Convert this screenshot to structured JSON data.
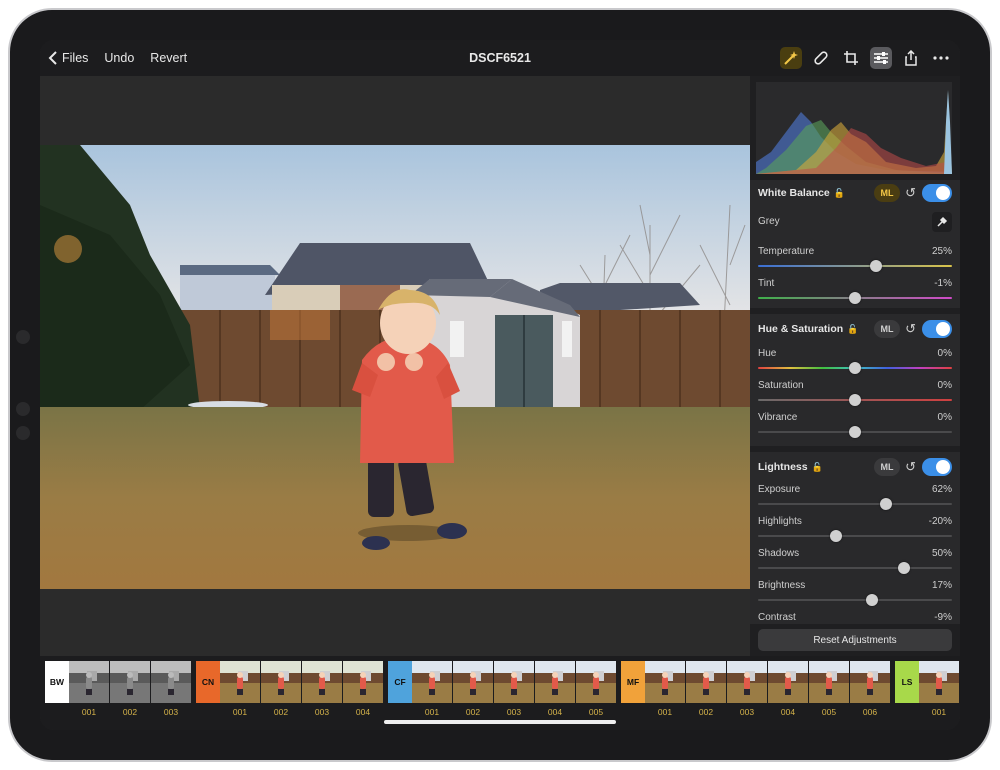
{
  "topbar": {
    "back_label": "Files",
    "undo_label": "Undo",
    "revert_label": "Revert",
    "title": "DSCF6521",
    "tools": [
      "ml-enhance-icon",
      "repair-bandage-icon",
      "crop-icon",
      "adjust-sliders-icon",
      "share-icon",
      "more-icon"
    ]
  },
  "panel": {
    "white_balance": {
      "title": "White Balance",
      "ml_label": "ML",
      "grey_label": "Grey",
      "rows": [
        {
          "label": "Temperature",
          "value": "25%",
          "level": 0.61
        },
        {
          "label": "Tint",
          "value": "-1%",
          "level": 0.5
        }
      ]
    },
    "hue_saturation": {
      "title": "Hue & Saturation",
      "ml_label": "ML",
      "rows": [
        {
          "label": "Hue",
          "value": "0%",
          "level": 0.5
        },
        {
          "label": "Saturation",
          "value": "0%",
          "level": 0.5
        },
        {
          "label": "Vibrance",
          "value": "0%",
          "level": 0.5
        }
      ]
    },
    "lightness": {
      "title": "Lightness",
      "ml_label": "ML",
      "rows": [
        {
          "label": "Exposure",
          "value": "62%",
          "level": 0.66
        },
        {
          "label": "Highlights",
          "value": "-20%",
          "level": 0.4
        },
        {
          "label": "Shadows",
          "value": "50%",
          "level": 0.75
        },
        {
          "label": "Brightness",
          "value": "17%",
          "level": 0.59
        },
        {
          "label": "Contrast",
          "value": "-9%",
          "level": 0.45
        }
      ]
    },
    "reset_label": "Reset Adjustments"
  },
  "presets": [
    {
      "code": "BW",
      "color": "#ffffff",
      "text_color": "#111111",
      "items": [
        "001",
        "002",
        "003"
      ]
    },
    {
      "code": "CN",
      "color": "#e8682a",
      "text_color": "#111111",
      "items": [
        "001",
        "002",
        "003",
        "004"
      ]
    },
    {
      "code": "CF",
      "color": "#4fa3dc",
      "text_color": "#111111",
      "items": [
        "001",
        "002",
        "003",
        "004",
        "005"
      ]
    },
    {
      "code": "MF",
      "color": "#f1a23a",
      "text_color": "#111111",
      "items": [
        "001",
        "002",
        "003",
        "004",
        "005",
        "006"
      ]
    },
    {
      "code": "LS",
      "color": "#a8d94a",
      "text_color": "#111111",
      "items": [
        "001"
      ]
    }
  ],
  "colors": {
    "accent": "#3b8fe8",
    "ml": "#f3c747"
  }
}
